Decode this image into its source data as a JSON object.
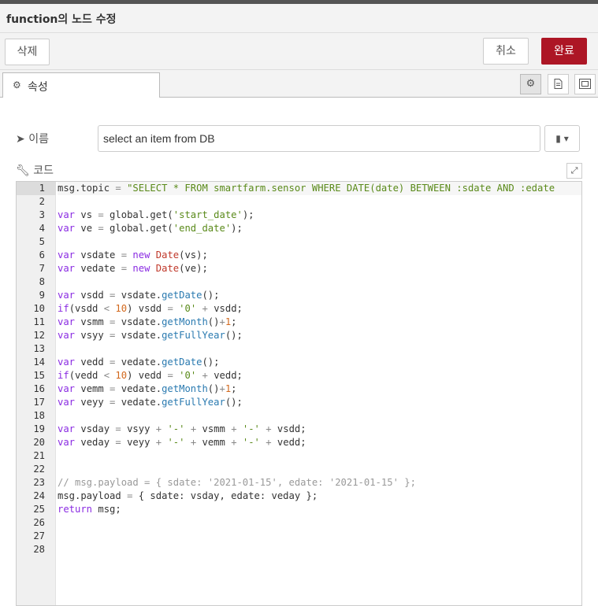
{
  "titlebar": {
    "title": "function의 노드 수정"
  },
  "actions": {
    "delete_label": "삭제",
    "cancel_label": "취소",
    "done_label": "완료"
  },
  "tabs": [
    {
      "label": "속성",
      "icon": "gear-icon"
    }
  ],
  "tab_icons": [
    "gear-icon",
    "document-icon",
    "expand-frame-icon"
  ],
  "name_field": {
    "label": "이름",
    "value": "select an item from DB",
    "icon": "tag-icon"
  },
  "code_field": {
    "label": "코드",
    "icon": "wrench-icon"
  },
  "editor": {
    "active_line": 1,
    "lines": [
      "msg.topic = \"SELECT * FROM smartfarm.sensor WHERE DATE(date) BETWEEN :sdate AND :edate",
      "",
      "var vs = global.get('start_date');",
      "var ve = global.get('end_date');",
      "",
      "var vsdate = new Date(vs);",
      "var vedate = new Date(ve);",
      "",
      "var vsdd = vsdate.getDate();",
      "if(vsdd < 10) vsdd = '0' + vsdd;",
      "var vsmm = vsdate.getMonth()+1;",
      "var vsyy = vsdate.getFullYear();",
      "",
      "var vedd = vedate.getDate();",
      "if(vedd < 10) vedd = '0' + vedd;",
      "var vemm = vedate.getMonth()+1;",
      "var veyy = vedate.getFullYear();",
      "",
      "var vsday = vsyy + '-' + vsmm + '-' + vsdd;",
      "var veday = veyy + '-' + vemm + '-' + vedd;",
      "",
      "",
      "// msg.payload = { sdate: '2021-01-15', edate: '2021-01-15' };",
      "msg.payload = { sdate: vsday, edate: veday };",
      "return msg;",
      "",
      "",
      ""
    ]
  },
  "colors": {
    "done_button": "#ad1625",
    "keyword": "#8a2be2",
    "string": "#5a8a1a",
    "method": "#2a7ab0",
    "number": "#d2691e"
  }
}
